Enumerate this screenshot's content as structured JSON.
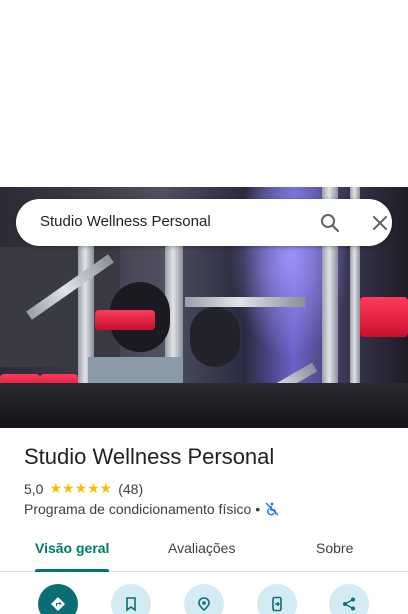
{
  "search": {
    "query": "Studio Wellness Personal"
  },
  "place": {
    "name": "Studio Wellness Personal",
    "rating": "5,0",
    "stars": "★★★★★",
    "review_count": "(48)",
    "category": "Programa de condicionamento físico",
    "separator": "•"
  },
  "tabs": [
    {
      "label": "Visão geral",
      "active": true
    },
    {
      "label": "Avaliações",
      "active": false
    },
    {
      "label": "Sobre",
      "active": false
    }
  ],
  "actions": [
    {
      "icon": "directions-icon"
    },
    {
      "icon": "bookmark-icon"
    },
    {
      "icon": "nearby-icon"
    },
    {
      "icon": "send-to-phone-icon"
    },
    {
      "icon": "share-icon"
    }
  ],
  "colors": {
    "accent": "#00796b",
    "star": "#fbbc04",
    "primary_action": "#0b6e74",
    "secondary_action": "#d3ecf3"
  }
}
